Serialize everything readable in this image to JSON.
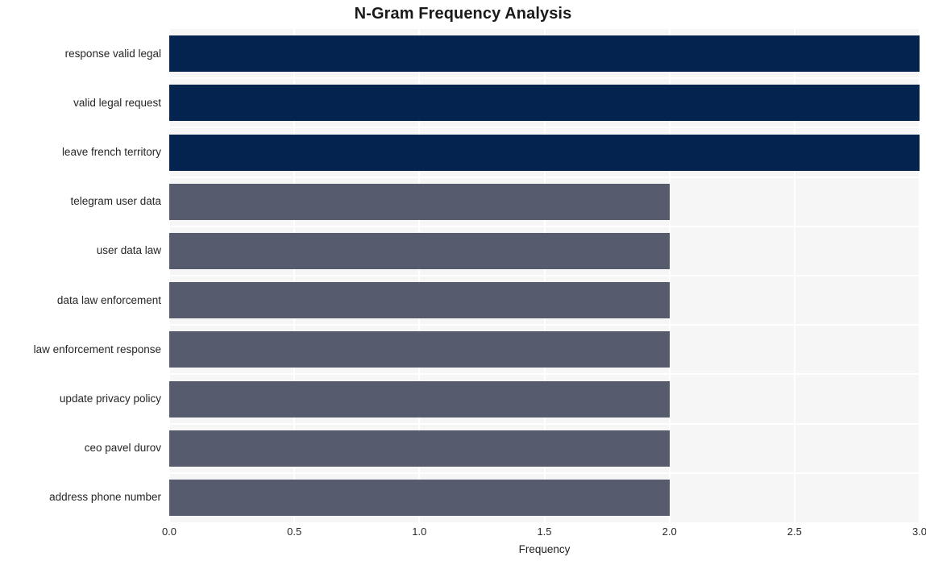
{
  "chart_data": {
    "type": "bar",
    "orientation": "horizontal",
    "title": "N-Gram Frequency Analysis",
    "xlabel": "Frequency",
    "ylabel": "",
    "categories": [
      "response valid legal",
      "valid legal request",
      "leave french territory",
      "telegram user data",
      "user data law",
      "data law enforcement",
      "law enforcement response",
      "update privacy policy",
      "ceo pavel durov",
      "address phone number"
    ],
    "values": [
      3,
      3,
      3,
      2,
      2,
      2,
      2,
      2,
      2,
      2
    ],
    "bar_colors": [
      "#04234f",
      "#04234f",
      "#04234f",
      "#565c6e",
      "#565c6e",
      "#565c6e",
      "#565c6e",
      "#565c6e",
      "#565c6e",
      "#565c6e"
    ],
    "xlim": [
      0.0,
      3.0
    ],
    "xticks": [
      0.0,
      0.5,
      1.0,
      1.5,
      2.0,
      2.5,
      3.0
    ],
    "xtick_labels": [
      "0.0",
      "0.5",
      "1.0",
      "1.5",
      "2.0",
      "2.5",
      "3.0"
    ],
    "grid": true,
    "grid_color": "#ffffff",
    "plot_background": "#f6f6f7",
    "figure_background": "#ffffff",
    "legend": null
  }
}
